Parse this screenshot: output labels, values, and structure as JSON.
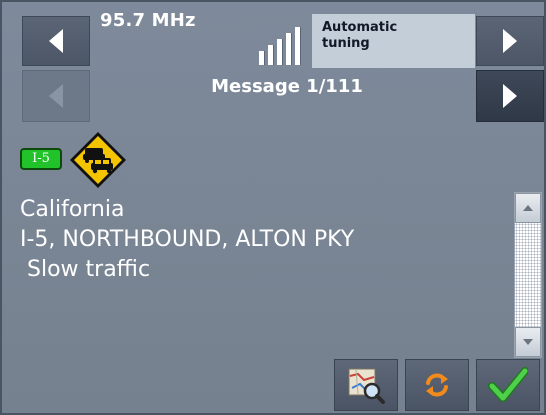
{
  "radio": {
    "frequency": "95.7 MHz",
    "tuning_mode_line1": "Automatic",
    "tuning_mode_line2": "tuning",
    "signal_bars": 5
  },
  "message": {
    "counter": "Message 1/111",
    "route_badge": "I-5",
    "lines": [
      "California",
      "I-5, NORTHBOUND, ALTON PKY",
      " Slow traffic"
    ],
    "event_icon": "traffic-jam-warning-sign"
  },
  "buttons": {
    "prev_station": "left-arrow-icon",
    "next_station": "right-arrow-icon",
    "prev_message": "left-arrow-icon",
    "next_message": "right-arrow-icon",
    "show_on_map": "map-magnifier-icon",
    "refresh": "refresh-icon",
    "confirm": "checkmark-icon"
  },
  "colors": {
    "background": "#7b8798",
    "text": "#ffffff",
    "route_badge": "#21c22a",
    "warning_sign": "#f5c400",
    "confirm": "#3cb83a"
  }
}
